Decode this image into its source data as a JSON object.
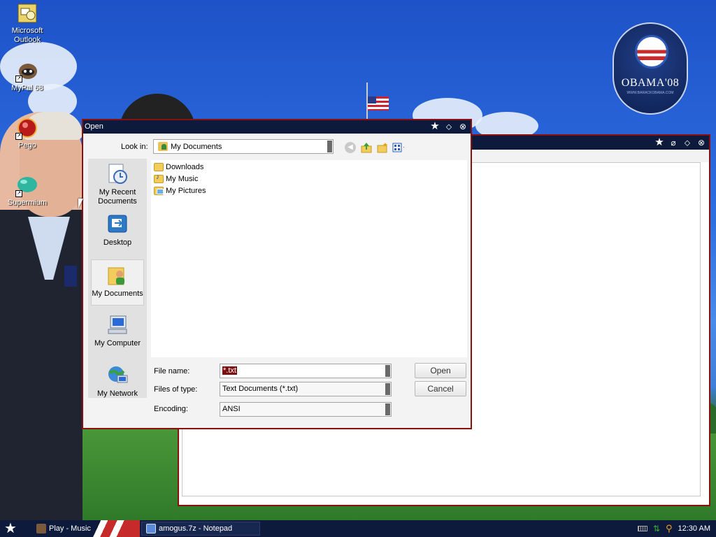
{
  "desktop": {
    "icons": [
      {
        "label": "Microsoft Outlook",
        "icon": "outlook-icon"
      },
      {
        "label": "MyPal 68",
        "icon": "mypal-icon"
      },
      {
        "label": "Pego",
        "icon": "pego-icon"
      },
      {
        "label": "Supermium",
        "icon": "supermium-icon"
      }
    ],
    "logo": {
      "text": "OBAMA'08",
      "url_text": "WWW.BARACKOBAMA.COM"
    }
  },
  "dialog": {
    "title": "Open",
    "look_in_label": "Look in:",
    "look_in_value": "My Documents",
    "places": [
      {
        "label": "My Recent Documents",
        "icon": "recent-documents-icon"
      },
      {
        "label": "Desktop",
        "icon": "desktop-icon"
      },
      {
        "label": "My Documents",
        "icon": "my-documents-icon",
        "selected": true
      },
      {
        "label": "My Computer",
        "icon": "my-computer-icon"
      },
      {
        "label": "My Network",
        "icon": "my-network-icon"
      }
    ],
    "files": [
      {
        "name": "Downloads",
        "icon": "folder-icon"
      },
      {
        "name": "My Music",
        "icon": "music-folder-icon"
      },
      {
        "name": "My Pictures",
        "icon": "pictures-folder-icon"
      }
    ],
    "file_name_label": "File name:",
    "file_name_value": "*.txt",
    "files_of_type_label": "Files of type:",
    "files_of_type_value": "Text Documents (*.txt)",
    "encoding_label": "Encoding:",
    "encoding_value": "ANSI",
    "open_button": "Open",
    "cancel_button": "Cancel"
  },
  "taskbar": {
    "tasks": [
      {
        "label": "Play - Music"
      },
      {
        "label": "amogus.7z - Notepad"
      }
    ],
    "clock": "12:30 AM"
  },
  "colors": {
    "titlebar": "#0d1a3c",
    "window_border": "#8a1010",
    "selection": "#7a1010"
  }
}
